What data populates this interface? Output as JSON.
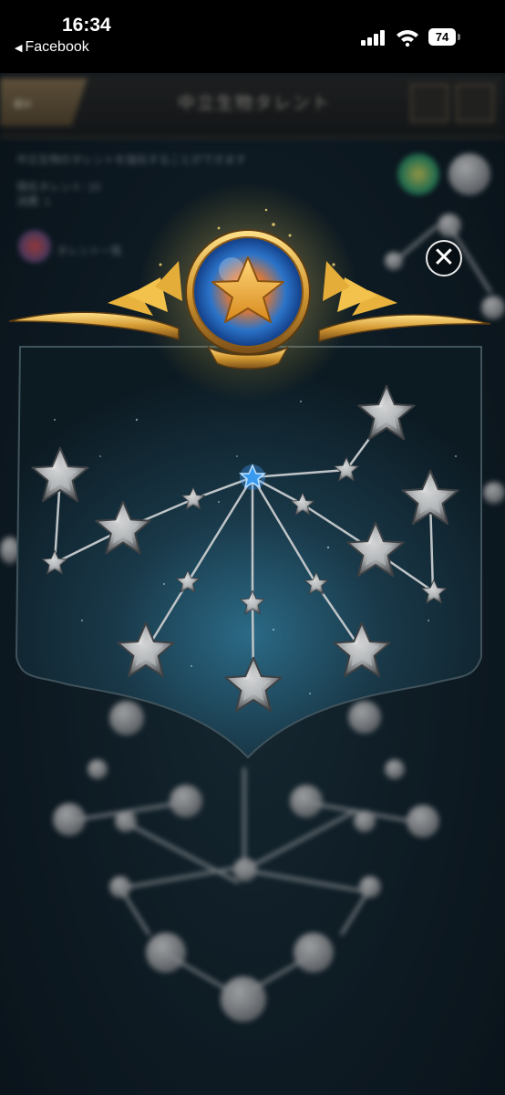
{
  "status_bar": {
    "time": "16:34",
    "back_app": "Facebook",
    "back_glyph": "◀",
    "battery": "74",
    "colors": {
      "background": "#000000",
      "text": "#ffffff"
    }
  },
  "game_header": {
    "title": "中立生物タレント",
    "back_glyph": "⇐",
    "subtext_1": "中立生物のタレントを強化することができます",
    "subtext_2": "現在タレント: 10",
    "subtext_3": "消費: 1",
    "subtext_4": "タレント一覧"
  },
  "close_button": {
    "glyph": "✕"
  },
  "talent_panel": {
    "emblem": "star-orb-emblem",
    "colors": {
      "panel": "#1c3a4a",
      "active_star": "#2f8fe0",
      "locked_star": "#9a9da0",
      "gold": "#d7a23a"
    }
  }
}
